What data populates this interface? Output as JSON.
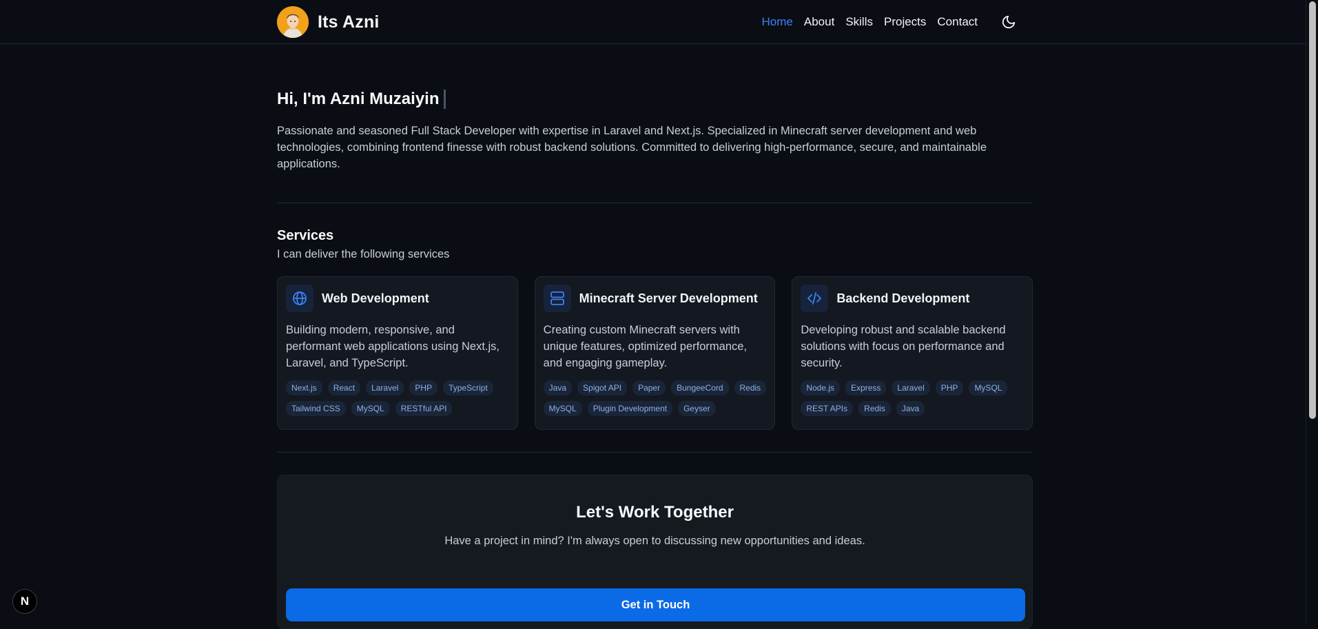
{
  "header": {
    "brand_name": "Its Azni",
    "nav": [
      "Home",
      "About",
      "Skills",
      "Projects",
      "Contact"
    ],
    "active_nav": "Home"
  },
  "hero": {
    "title": "Hi, I'm Azni Muzaiyin",
    "description": "Passionate and seasoned Full Stack Developer with expertise in Laravel and Next.js. Specialized in Minecraft server development and web technologies, combining frontend finesse with robust backend solutions. Committed to delivering high-performance, secure, and maintainable applications."
  },
  "services": {
    "title": "Services",
    "subtitle": "I can deliver the following services",
    "items": [
      {
        "icon": "globe-icon",
        "title": "Web Development",
        "description": "Building modern, responsive, and performant web applications using Next.js, Laravel, and TypeScript.",
        "tags": [
          "Next.js",
          "React",
          "Laravel",
          "PHP",
          "TypeScript",
          "Tailwind CSS",
          "MySQL",
          "RESTful API"
        ]
      },
      {
        "icon": "server-icon",
        "title": "Minecraft Server Development",
        "description": "Creating custom Minecraft servers with unique features, optimized performance, and engaging gameplay.",
        "tags": [
          "Java",
          "Spigot API",
          "Paper",
          "BungeeCord",
          "Redis",
          "MySQL",
          "Plugin Development",
          "Geyser"
        ]
      },
      {
        "icon": "code-icon",
        "title": "Backend Development",
        "description": "Developing robust and scalable backend solutions with focus on performance and security.",
        "tags": [
          "Node.js",
          "Express",
          "Laravel",
          "PHP",
          "MySQL",
          "REST APIs",
          "Redis",
          "Java"
        ]
      }
    ]
  },
  "cta": {
    "title": "Let's Work Together",
    "subtitle": "Have a project in mind? I'm always open to discussing new opportunities and ideas.",
    "button_label": "Get in Touch"
  },
  "badge": {
    "label": "N"
  },
  "colors": {
    "accent": "#0b6ae6",
    "active_nav": "#3b82f6",
    "background": "#0a0d14",
    "card": "#141820"
  }
}
